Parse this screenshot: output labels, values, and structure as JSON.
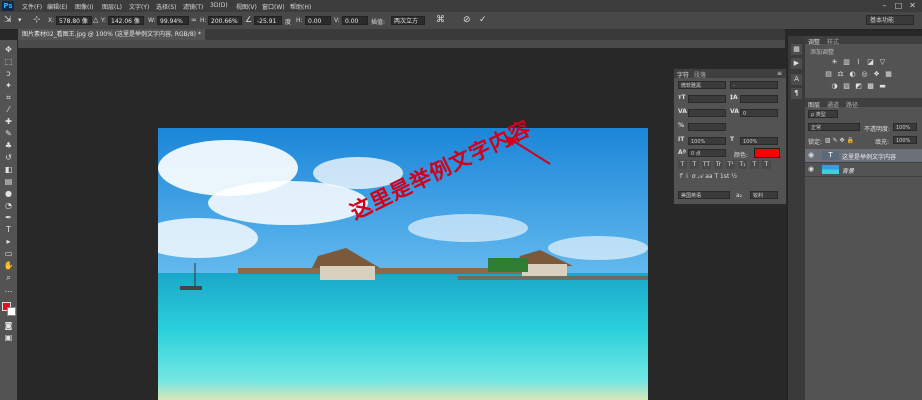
{
  "app": {
    "logo": "Ps"
  },
  "menu": {
    "items": [
      "文件(F)",
      "编辑(E)",
      "图像(I)",
      "图层(L)",
      "文字(Y)",
      "选择(S)",
      "滤镜(T)",
      "3D(D)",
      "视图(V)",
      "窗口(W)",
      "帮助(H)"
    ]
  },
  "window_controls": [
    "–",
    "□",
    "✕"
  ],
  "options": {
    "x_label": "X:",
    "x_value": "578.80 像",
    "y_label": "Y:",
    "y_value": "142.06 像",
    "w_label": "W:",
    "w_value": "99.94%",
    "h_label": "H:",
    "h_value": "200.66%",
    "angle_value": "-25.91",
    "hskew_label": "H:",
    "hskew_value": "0.00",
    "vskew_label": "V:",
    "vskew_value": "0.00",
    "interp_label": "插值:",
    "interp_value": "两次立方",
    "workspace": "基本功能"
  },
  "document": {
    "tab_title": "图片素材02_看图王.jpg @ 100% (这里是举例文字内容, RGB/8) *",
    "overlay_text": "这里是举例文字内容",
    "overlay_color": "#d0021b"
  },
  "character_panel": {
    "tabs": [
      "字符",
      "段落"
    ],
    "font_family": "微软雅黑",
    "font_style": "-",
    "size": "",
    "leading": "",
    "tracking": "0",
    "scale": "100%",
    "baseline": "0 点",
    "color_label": "颜色:",
    "color": "#ff0000",
    "text_buttons": [
      "T",
      "T",
      "TT",
      "Tr",
      "T¹",
      "T₁",
      "T",
      "T"
    ],
    "language": "美国英语",
    "aa_label": "a₂",
    "aa_value": "锐利"
  },
  "adjust_panel": {
    "tabs": [
      "调整",
      "样式"
    ],
    "subtitle": "添加调整"
  },
  "layers_panel": {
    "tabs": [
      "图层",
      "通道",
      "路径"
    ],
    "kind": "ρ 类型",
    "blend": "正常",
    "opacity_label": "不透明度:",
    "opacity": "100%",
    "lock_label": "锁定:",
    "fill_label": "填充:",
    "fill": "100%",
    "layers": [
      {
        "name": "这里是举例文字内容",
        "type": "text",
        "selected": true
      },
      {
        "name": "背景",
        "type": "image",
        "selected": false
      }
    ]
  }
}
